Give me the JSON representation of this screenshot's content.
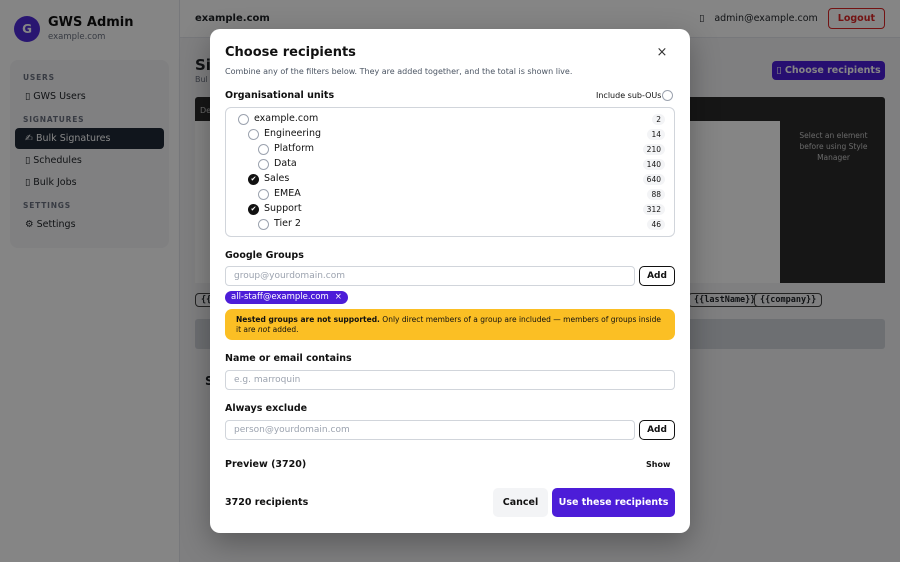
{
  "brand": {
    "avatar": "G",
    "title": "GWS Admin",
    "subtitle": "example.com"
  },
  "sidebar": {
    "sections": [
      {
        "label": "USERS",
        "items": [
          {
            "icon": "person-icon",
            "glyph": "▯",
            "label": "GWS Users"
          }
        ]
      },
      {
        "label": "SIGNATURES",
        "items": [
          {
            "icon": "pen-icon",
            "glyph": "✍",
            "label": "Bulk Signatures",
            "active": true
          },
          {
            "icon": "calendar-icon",
            "glyph": "▯",
            "label": "Schedules"
          },
          {
            "icon": "jobs-icon",
            "glyph": "▯",
            "label": "Bulk Jobs"
          }
        ]
      },
      {
        "label": "SETTINGS",
        "items": [
          {
            "icon": "gear-icon",
            "glyph": "⚙",
            "label": "Settings"
          }
        ]
      }
    ]
  },
  "topbar": {
    "domain": "example.com",
    "user_glyph": "▯",
    "user": "admin@example.com",
    "logout": "Logout"
  },
  "page": {
    "title": "Si",
    "subtitle": "Bul",
    "choose_button": "▯ Choose recipients",
    "editor_tab": "De",
    "editor_hint": "Select an element before using Style Manager",
    "tags": [
      "{{",
      "{{lastName}}",
      "{{company}}"
    ],
    "section_letter": "S"
  },
  "modal": {
    "title": "Choose recipients",
    "close": "×",
    "description": "Combine any of the filters below. They are added together, and the total is shown live.",
    "ou": {
      "label": "Organisational units",
      "include_sub": "Include sub-OUs",
      "items": [
        {
          "name": "example.com",
          "count": "2",
          "level": 0,
          "checked": false
        },
        {
          "name": "Engineering",
          "count": "14",
          "level": 1,
          "checked": false
        },
        {
          "name": "Platform",
          "count": "210",
          "level": 2,
          "checked": false
        },
        {
          "name": "Data",
          "count": "140",
          "level": 2,
          "checked": false
        },
        {
          "name": "Sales",
          "count": "640",
          "level": 1,
          "checked": true
        },
        {
          "name": "EMEA",
          "count": "88",
          "level": 2,
          "checked": false
        },
        {
          "name": "Support",
          "count": "312",
          "level": 1,
          "checked": true
        },
        {
          "name": "Tier 2",
          "count": "46",
          "level": 2,
          "checked": false
        }
      ]
    },
    "groups": {
      "label": "Google Groups",
      "placeholder": "group@yourdomain.com",
      "add": "Add",
      "chip": "all-staff@example.com",
      "chip_remove": "×"
    },
    "warning": {
      "bold": "Nested groups are not supported.",
      "text1": " Only direct members of a group are included — members of groups inside it are ",
      "em": "not",
      "text2": " added."
    },
    "name_filter": {
      "label": "Name or email contains",
      "placeholder": "e.g. marroquin"
    },
    "exclude": {
      "label": "Always exclude",
      "placeholder": "person@yourdomain.com",
      "add": "Add"
    },
    "preview": {
      "label": "Preview (3720)",
      "show": "Show"
    },
    "footer": {
      "count": "3720 recipients",
      "cancel": "Cancel",
      "confirm": "Use these recipients"
    }
  }
}
